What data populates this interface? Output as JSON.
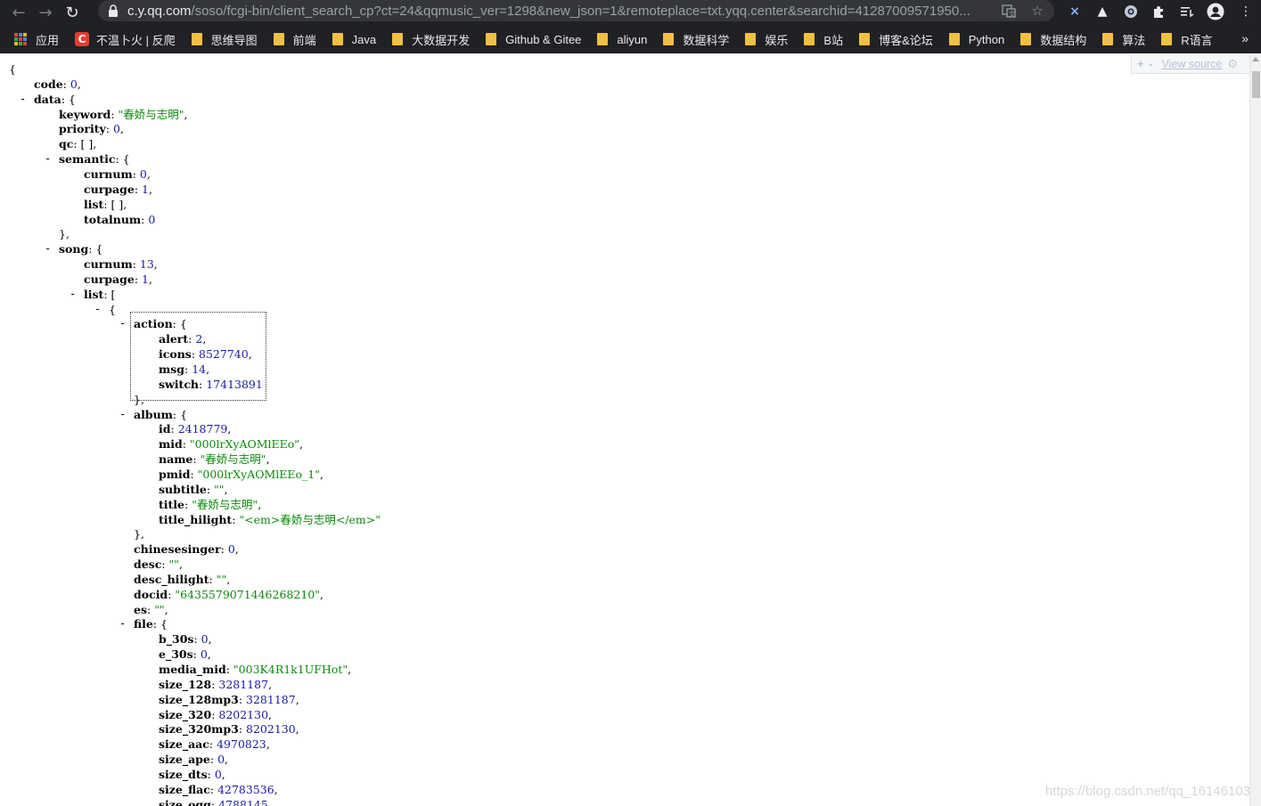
{
  "browser": {
    "url_host": "c.y.qq.com",
    "url_path": "/soso/fcgi-bin/client_search_cp?ct=24&qqmusic_ver=1298&new_json=1&remoteplace=txt.yqq.center&searchid=41287009571950...",
    "back_icon": "arrow-left-icon",
    "forward_icon": "arrow-right-icon",
    "reload_icon": "reload-icon"
  },
  "bookmarks": [
    {
      "label": "应用",
      "type": "apps"
    },
    {
      "label": "不温卜火 | 反爬",
      "type": "csdn"
    },
    {
      "label": "思维导图",
      "type": "folder"
    },
    {
      "label": "前端",
      "type": "folder"
    },
    {
      "label": "Java",
      "type": "folder"
    },
    {
      "label": "大数据开发",
      "type": "folder"
    },
    {
      "label": "Github & Gitee",
      "type": "folder"
    },
    {
      "label": "aliyun",
      "type": "folder"
    },
    {
      "label": "数据科学",
      "type": "folder"
    },
    {
      "label": "娱乐",
      "type": "folder"
    },
    {
      "label": "B站",
      "type": "folder"
    },
    {
      "label": "博客&论坛",
      "type": "folder"
    },
    {
      "label": "Python",
      "type": "folder"
    },
    {
      "label": "数据结构",
      "type": "folder"
    },
    {
      "label": "算法",
      "type": "folder"
    },
    {
      "label": "R语言",
      "type": "folder"
    }
  ],
  "viewer": {
    "view_source_label": "View source",
    "watermark": "https://blog.csdn.net/qq_16146103"
  },
  "json_lines": [
    {
      "depth": 0,
      "toggle": false,
      "open": "{"
    },
    {
      "depth": 1,
      "toggle": false,
      "key": "code",
      "value": "0",
      "vtype": "num",
      "comma": true
    },
    {
      "depth": 1,
      "toggle": true,
      "key": "data",
      "open": "{"
    },
    {
      "depth": 2,
      "toggle": false,
      "key": "keyword",
      "value": "\"春娇与志明\"",
      "vtype": "str",
      "comma": true
    },
    {
      "depth": 2,
      "toggle": false,
      "key": "priority",
      "value": "0",
      "vtype": "num",
      "comma": true
    },
    {
      "depth": 2,
      "toggle": false,
      "key": "qc",
      "value": "[ ]",
      "vtype": "punct",
      "comma": true
    },
    {
      "depth": 2,
      "toggle": true,
      "key": "semantic",
      "open": "{"
    },
    {
      "depth": 3,
      "toggle": false,
      "key": "curnum",
      "value": "0",
      "vtype": "num",
      "comma": true
    },
    {
      "depth": 3,
      "toggle": false,
      "key": "curpage",
      "value": "1",
      "vtype": "num",
      "comma": true
    },
    {
      "depth": 3,
      "toggle": false,
      "key": "list",
      "value": "[ ]",
      "vtype": "punct",
      "comma": true
    },
    {
      "depth": 3,
      "toggle": false,
      "key": "totalnum",
      "value": "0",
      "vtype": "num",
      "comma": false
    },
    {
      "depth": 2,
      "toggle": false,
      "close": "},"
    },
    {
      "depth": 2,
      "toggle": true,
      "key": "song",
      "open": "{"
    },
    {
      "depth": 3,
      "toggle": false,
      "key": "curnum",
      "value": "13",
      "vtype": "num",
      "comma": true
    },
    {
      "depth": 3,
      "toggle": false,
      "key": "curpage",
      "value": "1",
      "vtype": "num",
      "comma": true
    },
    {
      "depth": 3,
      "toggle": true,
      "key": "list",
      "open": "["
    },
    {
      "depth": 4,
      "toggle": true,
      "open": "{"
    },
    {
      "depth": 5,
      "toggle": true,
      "key": "action",
      "open": "{"
    },
    {
      "depth": 6,
      "toggle": false,
      "key": "alert",
      "value": "2",
      "vtype": "num",
      "comma": true
    },
    {
      "depth": 6,
      "toggle": false,
      "key": "icons",
      "value": "8527740",
      "vtype": "num",
      "comma": true
    },
    {
      "depth": 6,
      "toggle": false,
      "key": "msg",
      "value": "14",
      "vtype": "num",
      "comma": true
    },
    {
      "depth": 6,
      "toggle": false,
      "key": "switch",
      "value": "17413891",
      "vtype": "num",
      "comma": false
    },
    {
      "depth": 5,
      "toggle": false,
      "close": "},"
    },
    {
      "depth": 5,
      "toggle": true,
      "key": "album",
      "open": "{"
    },
    {
      "depth": 6,
      "toggle": false,
      "key": "id",
      "value": "2418779",
      "vtype": "num",
      "comma": true
    },
    {
      "depth": 6,
      "toggle": false,
      "key": "mid",
      "value": "\"000lrXyAOMlEEo\"",
      "vtype": "str",
      "comma": true
    },
    {
      "depth": 6,
      "toggle": false,
      "key": "name",
      "value": "\"春娇与志明\"",
      "vtype": "str",
      "comma": true
    },
    {
      "depth": 6,
      "toggle": false,
      "key": "pmid",
      "value": "\"000lrXyAOMlEEo_1\"",
      "vtype": "str",
      "comma": true
    },
    {
      "depth": 6,
      "toggle": false,
      "key": "subtitle",
      "value": "\"\"",
      "vtype": "str",
      "comma": true
    },
    {
      "depth": 6,
      "toggle": false,
      "key": "title",
      "value": "\"春娇与志明\"",
      "vtype": "str",
      "comma": true
    },
    {
      "depth": 6,
      "toggle": false,
      "key": "title_hilight",
      "value": "\"<em>春娇与志明</em>\"",
      "vtype": "str",
      "comma": false
    },
    {
      "depth": 5,
      "toggle": false,
      "close": "},"
    },
    {
      "depth": 5,
      "toggle": false,
      "key": "chinesesinger",
      "value": "0",
      "vtype": "num",
      "comma": true
    },
    {
      "depth": 5,
      "toggle": false,
      "key": "desc",
      "value": "\"\"",
      "vtype": "str",
      "comma": true
    },
    {
      "depth": 5,
      "toggle": false,
      "key": "desc_hilight",
      "value": "\"\"",
      "vtype": "str",
      "comma": true
    },
    {
      "depth": 5,
      "toggle": false,
      "key": "docid",
      "value": "\"6435579071446268210\"",
      "vtype": "str",
      "comma": true
    },
    {
      "depth": 5,
      "toggle": false,
      "key": "es",
      "value": "\"\"",
      "vtype": "str",
      "comma": true
    },
    {
      "depth": 5,
      "toggle": true,
      "key": "file",
      "open": "{"
    },
    {
      "depth": 6,
      "toggle": false,
      "key": "b_30s",
      "value": "0",
      "vtype": "num",
      "comma": true
    },
    {
      "depth": 6,
      "toggle": false,
      "key": "e_30s",
      "value": "0",
      "vtype": "num",
      "comma": true
    },
    {
      "depth": 6,
      "toggle": false,
      "key": "media_mid",
      "value": "\"003K4R1k1UFHot\"",
      "vtype": "str",
      "comma": true
    },
    {
      "depth": 6,
      "toggle": false,
      "key": "size_128",
      "value": "3281187",
      "vtype": "num",
      "comma": true
    },
    {
      "depth": 6,
      "toggle": false,
      "key": "size_128mp3",
      "value": "3281187",
      "vtype": "num",
      "comma": true
    },
    {
      "depth": 6,
      "toggle": false,
      "key": "size_320",
      "value": "8202130",
      "vtype": "num",
      "comma": true
    },
    {
      "depth": 6,
      "toggle": false,
      "key": "size_320mp3",
      "value": "8202130",
      "vtype": "num",
      "comma": true
    },
    {
      "depth": 6,
      "toggle": false,
      "key": "size_aac",
      "value": "4970823",
      "vtype": "num",
      "comma": true
    },
    {
      "depth": 6,
      "toggle": false,
      "key": "size_ape",
      "value": "0",
      "vtype": "num",
      "comma": true
    },
    {
      "depth": 6,
      "toggle": false,
      "key": "size_dts",
      "value": "0",
      "vtype": "num",
      "comma": true
    },
    {
      "depth": 6,
      "toggle": false,
      "key": "size_flac",
      "value": "42783536",
      "vtype": "num",
      "comma": true
    },
    {
      "depth": 6,
      "toggle": false,
      "key": "size_ogg",
      "value": "4788145",
      "vtype": "num",
      "comma": true
    }
  ]
}
